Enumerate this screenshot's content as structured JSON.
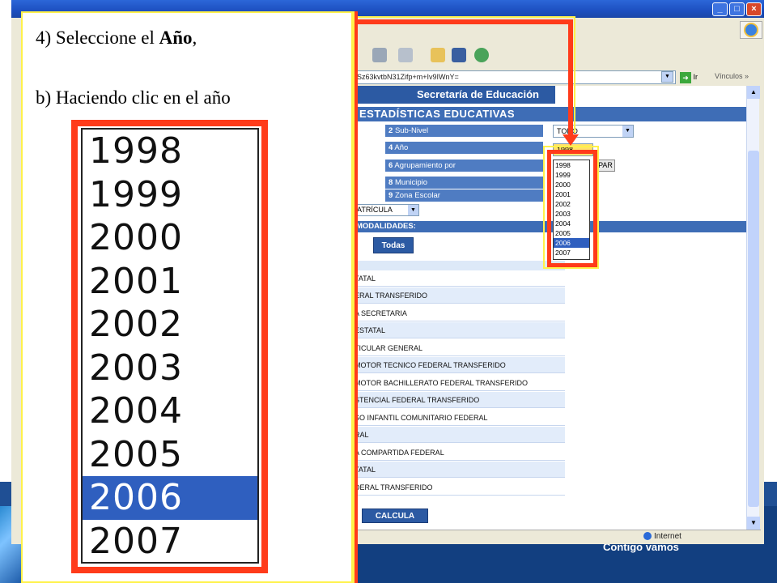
{
  "instructions": {
    "line1_prefix": "4) Seleccione el ",
    "line1_bold": "Año",
    "line1_suffix": ",",
    "line2": "b) Haciendo clic en el año"
  },
  "year_options": [
    "1998",
    "1999",
    "2000",
    "2001",
    "2002",
    "2003",
    "2004",
    "2005",
    "2006",
    "2007"
  ],
  "selected_year": "2006",
  "browser": {
    "address_value": "XSz63kvtbN31Zifp+m+Iv9IWnY=",
    "go_label": "Ir",
    "links_label": "Vínculos »",
    "status_zone": "Internet"
  },
  "page": {
    "banner": "Secretaría de Educación",
    "stats_header": "ESTADÍSTICAS EDUCATIVAS",
    "params": [
      {
        "num": "2",
        "label": "Sub-Nivel"
      },
      {
        "num": "4",
        "label": "Año"
      },
      {
        "num": "6",
        "label": "Agrupamiento por"
      },
      {
        "num": "8",
        "label": "Municipio"
      },
      {
        "num": "9",
        "label": "Zona Escolar"
      }
    ],
    "nivel_value": "TODO",
    "year_select_value": "1998",
    "agrupamiento_button": "PAR",
    "matricula_value": "ATRÍCULA",
    "modalidades_header": "MODALIDADES:",
    "todas_button": "Todas",
    "modalidades": [
      "TATAL",
      "ERAL TRANSFERIDO",
      "A SECRETARIA",
      "ESTATAL",
      "TICULAR GENERAL",
      "MOTOR TECNICO FEDERAL TRANSFERIDO",
      "MOTOR BACHILLERATO FEDERAL TRANSFERIDO",
      "STENCIAL FEDERAL TRANSFERIDO",
      "SO INFANTIL COMUNITARIO FEDERAL",
      "RAL",
      "A COMPARTIDA FEDERAL",
      "TATAL",
      "DERAL TRANSFERIDO"
    ],
    "calcula_button": "CALCULA"
  },
  "slide_footer": "Contigo vamos"
}
